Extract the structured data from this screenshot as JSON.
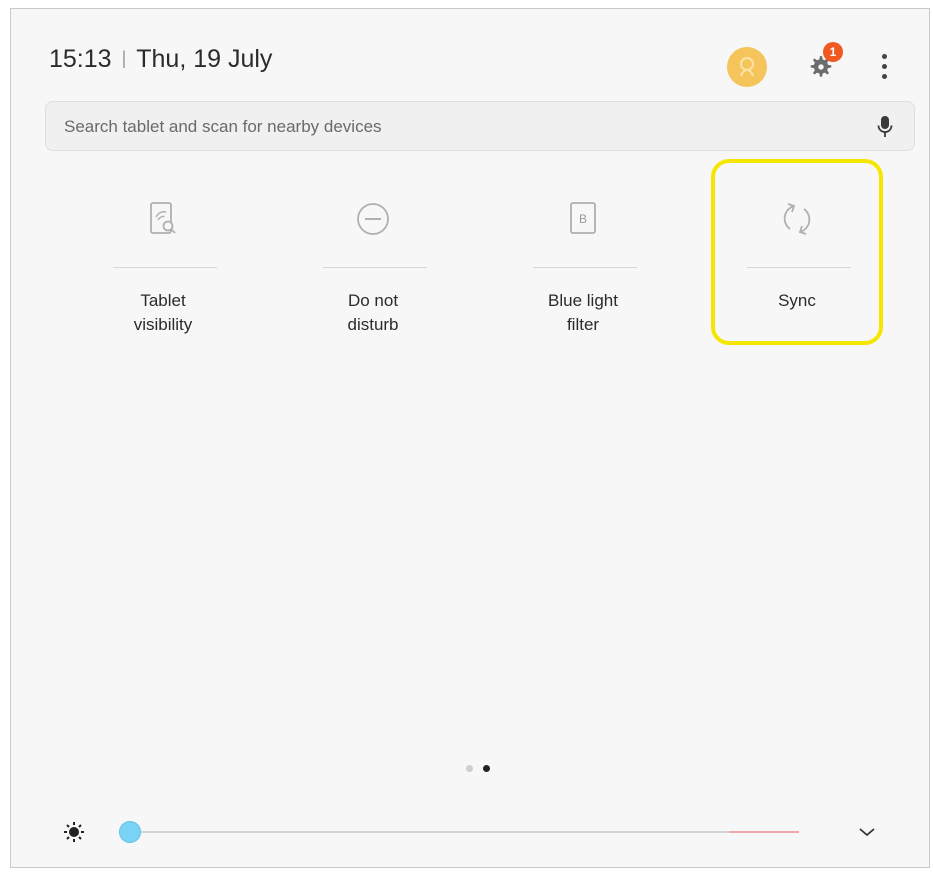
{
  "status": {
    "time": "15:13",
    "separator": "|",
    "date": "Thu, 19 July",
    "notification_count": "1"
  },
  "search": {
    "placeholder": "Search tablet and scan for nearby devices"
  },
  "tiles": [
    {
      "label": "Tablet\nvisibility",
      "icon": "tablet-visibility-icon"
    },
    {
      "label": "Do not\ndisturb",
      "icon": "do-not-disturb-icon"
    },
    {
      "label": "Blue light\nfilter",
      "icon": "blue-light-filter-icon"
    },
    {
      "label": "Sync",
      "icon": "sync-icon"
    }
  ],
  "pagination": {
    "pages": 2,
    "current": 2
  },
  "brightness": {
    "level": 0.0
  },
  "colors": {
    "highlight": "#f5e600",
    "badge": "#f05a22",
    "avatar": "#f5c45a",
    "slider_thumb": "#7ad2f5"
  }
}
